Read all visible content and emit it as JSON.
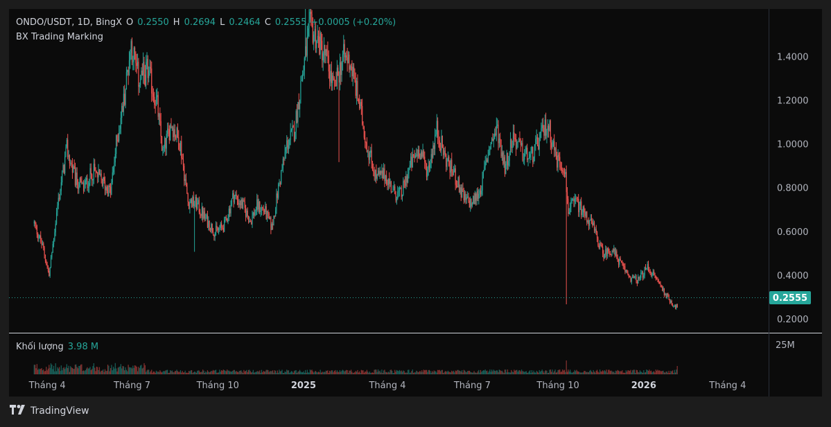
{
  "legend": {
    "symbol": "ONDO/USDT, 1D, BingX",
    "open_label": "O",
    "open": "0.2550",
    "high_label": "H",
    "high": "0.2694",
    "low_label": "L",
    "low": "0.2464",
    "close_label": "C",
    "close": "0.2555",
    "change": "+0.0005 (+0.20%)",
    "indicator": "BX Trading Marking"
  },
  "volume": {
    "label": "Khối lượng",
    "value": "3.98 M",
    "axis_label": "25M"
  },
  "last_price_tag": "0.2555",
  "branding": {
    "name": "TradingView",
    "icon": "tradingview-logo-icon"
  },
  "colors": {
    "up": "#26a69a",
    "down": "#ef5350",
    "background": "#0b0b0b",
    "page": "#1c1c1c",
    "price_tag": "#26a69a"
  },
  "chart_data": {
    "type": "candlestick",
    "symbol": "ONDO/USDT",
    "interval": "1D",
    "exchange": "BingX",
    "y_axis": {
      "ticks": [
        "1.4000",
        "1.2000",
        "1.0000",
        "0.8000",
        "0.6000",
        "0.4000",
        "0.2000"
      ],
      "ylim": [
        0.14,
        1.62
      ]
    },
    "x_axis": {
      "tick_labels": [
        "Tháng 4",
        "Tháng 7",
        "Tháng 10",
        "2025",
        "Tháng 4",
        "Tháng 7",
        "Tháng 10",
        "2026",
        "Tháng 4"
      ],
      "tick_dates": [
        "2024-04-01",
        "2024-07-01",
        "2024-10-01",
        "2025-01-01",
        "2025-04-01",
        "2025-07-01",
        "2025-10-01",
        "2026-01-01",
        "2026-04-01"
      ],
      "bold": [
        false,
        false,
        false,
        true,
        false,
        false,
        false,
        true,
        false
      ],
      "range": [
        "2024-02-20",
        "2026-05-15"
      ]
    },
    "grid": false,
    "last_close": 0.2555,
    "path": [
      [
        "2024-03-18",
        0.64
      ],
      [
        "2024-03-28",
        0.52
      ],
      [
        "2024-04-03",
        0.4
      ],
      [
        "2024-04-12",
        0.72
      ],
      [
        "2024-04-22",
        0.98
      ],
      [
        "2024-05-01",
        0.84
      ],
      [
        "2024-05-10",
        0.8
      ],
      [
        "2024-05-20",
        0.88
      ],
      [
        "2024-05-30",
        0.83
      ],
      [
        "2024-06-08",
        0.78
      ],
      [
        "2024-06-14",
        1.0
      ],
      [
        "2024-06-22",
        1.2
      ],
      [
        "2024-06-30",
        1.46
      ],
      [
        "2024-07-08",
        1.3
      ],
      [
        "2024-07-18",
        1.34
      ],
      [
        "2024-07-28",
        1.18
      ],
      [
        "2024-08-03",
        0.96
      ],
      [
        "2024-08-12",
        1.1
      ],
      [
        "2024-08-22",
        1.0
      ],
      [
        "2024-08-30",
        0.74
      ],
      [
        "2024-09-08",
        0.73
      ],
      [
        "2024-09-18",
        0.66
      ],
      [
        "2024-09-28",
        0.6
      ],
      [
        "2024-10-08",
        0.63
      ],
      [
        "2024-10-18",
        0.77
      ],
      [
        "2024-10-28",
        0.72
      ],
      [
        "2024-11-05",
        0.65
      ],
      [
        "2024-11-12",
        0.72
      ],
      [
        "2024-11-20",
        0.7
      ],
      [
        "2024-11-28",
        0.62
      ],
      [
        "2024-12-05",
        0.8
      ],
      [
        "2024-12-14",
        1.0
      ],
      [
        "2024-12-22",
        1.06
      ],
      [
        "2024-12-30",
        1.3
      ],
      [
        "2025-01-08",
        1.54
      ],
      [
        "2025-01-16",
        1.48
      ],
      [
        "2025-01-25",
        1.4
      ],
      [
        "2025-02-03",
        1.25
      ],
      [
        "2025-02-12",
        1.4
      ],
      [
        "2025-02-20",
        1.38
      ],
      [
        "2025-03-01",
        1.2
      ],
      [
        "2025-03-10",
        1.0
      ],
      [
        "2025-03-20",
        0.85
      ],
      [
        "2025-03-30",
        0.86
      ],
      [
        "2025-04-08",
        0.78
      ],
      [
        "2025-04-16",
        0.77
      ],
      [
        "2025-04-25",
        0.9
      ],
      [
        "2025-05-05",
        0.98
      ],
      [
        "2025-05-14",
        0.88
      ],
      [
        "2025-05-24",
        1.07
      ],
      [
        "2025-06-02",
        0.94
      ],
      [
        "2025-06-12",
        0.86
      ],
      [
        "2025-06-22",
        0.75
      ],
      [
        "2025-07-01",
        0.73
      ],
      [
        "2025-07-10",
        0.8
      ],
      [
        "2025-07-20",
        1.0
      ],
      [
        "2025-07-28",
        1.07
      ],
      [
        "2025-08-05",
        0.9
      ],
      [
        "2025-08-14",
        1.04
      ],
      [
        "2025-08-24",
        0.96
      ],
      [
        "2025-09-02",
        0.94
      ],
      [
        "2025-09-12",
        1.03
      ],
      [
        "2025-09-20",
        1.1
      ],
      [
        "2025-09-30",
        0.93
      ],
      [
        "2025-10-08",
        0.9
      ],
      [
        "2025-10-12",
        0.7
      ],
      [
        "2025-10-20",
        0.74
      ],
      [
        "2025-10-30",
        0.68
      ],
      [
        "2025-11-08",
        0.62
      ],
      [
        "2025-11-18",
        0.5
      ],
      [
        "2025-11-28",
        0.52
      ],
      [
        "2025-12-08",
        0.45
      ],
      [
        "2025-12-18",
        0.39
      ],
      [
        "2025-12-26",
        0.38
      ],
      [
        "2026-01-05",
        0.44
      ],
      [
        "2026-01-14",
        0.39
      ],
      [
        "2026-01-24",
        0.32
      ],
      [
        "2026-02-01",
        0.27
      ],
      [
        "2026-02-06",
        0.2555
      ]
    ],
    "wick_events": [
      {
        "date": "2024-09-06",
        "low": 0.51
      },
      {
        "date": "2025-01-03",
        "high": 1.62
      },
      {
        "date": "2025-02-08",
        "low": 0.92
      },
      {
        "date": "2025-10-10",
        "low": 0.27
      }
    ]
  }
}
